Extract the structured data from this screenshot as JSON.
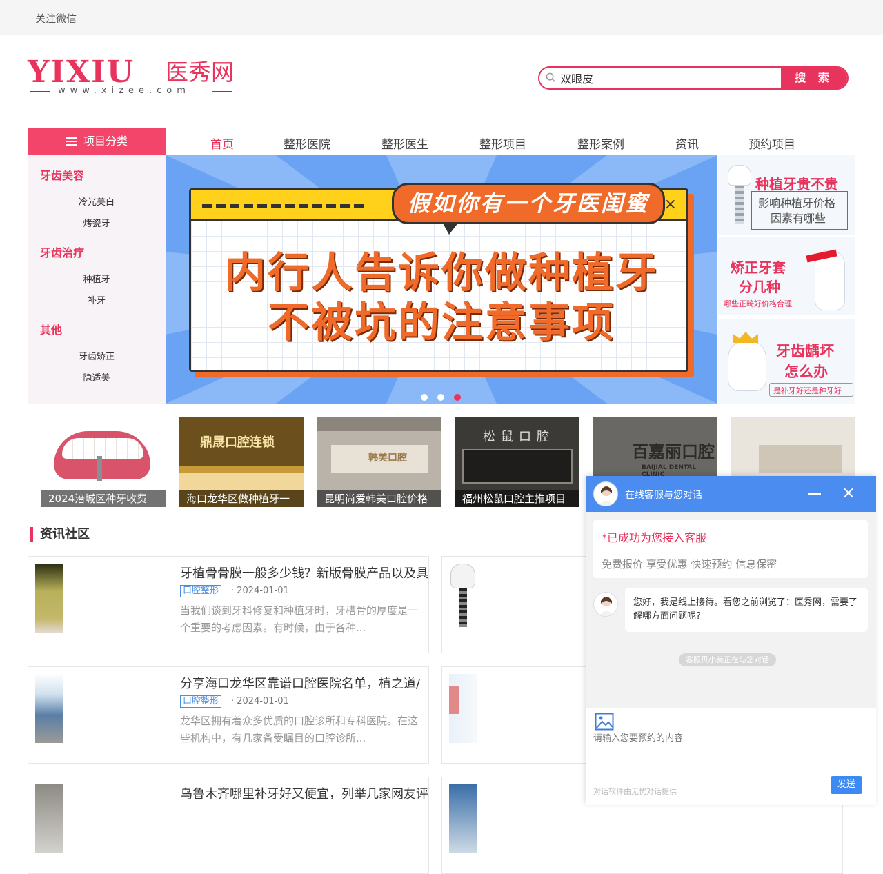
{
  "topbar": {
    "follow_wechat": "关注微信"
  },
  "logo": {
    "en": "YIXIU",
    "cn": "医秀网",
    "url": "www.xizee.com"
  },
  "search": {
    "value": "双眼皮",
    "button": "搜 索"
  },
  "nav": {
    "category_button": "项目分类",
    "items": [
      {
        "label": "首页",
        "active": true
      },
      {
        "label": "整形医院"
      },
      {
        "label": "整形医生"
      },
      {
        "label": "整形项目"
      },
      {
        "label": "整形案例"
      },
      {
        "label": "资讯"
      },
      {
        "label": "预约项目"
      }
    ]
  },
  "sidebar": {
    "groups": [
      {
        "title": "牙齿美容",
        "items": [
          "冷光美白",
          "烤瓷牙"
        ]
      },
      {
        "title": "牙齿治疗",
        "items": [
          "种植牙",
          "补牙"
        ]
      },
      {
        "title": "其他",
        "items": [
          "牙齿矫正",
          "隐适美"
        ]
      }
    ]
  },
  "banner": {
    "bubble": "假如你有一个牙医闺蜜",
    "line1": "内行人告诉你做种植牙",
    "line2": "不被坑的注意事项",
    "close": "×",
    "dots": 3,
    "active_dot": 2
  },
  "promos": [
    {
      "t1": "种植牙贵不贵",
      "t2": "影响种植牙价格",
      "t3": "因素有哪些"
    },
    {
      "t1": "矫正牙套",
      "t2": "分几种",
      "t3": "哪些正畸好价格合理"
    },
    {
      "t1": "牙齿龋坏",
      "t2": "怎么办",
      "t3": "是补牙好还是种牙好"
    }
  ],
  "thumbnails": [
    {
      "caption": "2024涪城区种牙收费"
    },
    {
      "caption": "海口龙华区做种植牙一"
    },
    {
      "caption": "昆明尚爱韩美口腔价格"
    },
    {
      "caption": "福州松鼠口腔主推项目"
    },
    {
      "caption": ""
    },
    {
      "caption": ""
    }
  ],
  "thumb_signs": {
    "t2": "鼎晟口腔连锁",
    "t3": "韩美口腔",
    "t4": "松鼠口腔",
    "t5": "百嘉丽口腔",
    "t5_en": "BAIJIAL DENTAL CLINIC"
  },
  "section": {
    "title": "资讯社区"
  },
  "articles": [
    {
      "title": "牙植骨骨膜一般多少钱？新版骨膜产品以及具",
      "tag": "口腔整形",
      "date": "· 2024-01-01",
      "desc": "当我们谈到牙科修复和种植牙时，牙槽骨的厚度是一个重要的考虑因素。有时候，由于各种..."
    },
    {
      "title": "分享海口龙华区靠谱口腔医院名单，植之道/",
      "tag": "口腔整形",
      "date": "· 2024-01-01",
      "desc": "龙华区拥有着众多优质的口腔诊所和专科医院。在这些机构中，有几家备受瞩目的口腔诊所..."
    },
    {
      "title": "乌鲁木齐哪里补牙好又便宜，列举几家网友评",
      "tag": "",
      "date": "",
      "desc": ""
    }
  ],
  "chat": {
    "title": "在线客服与您对话",
    "close": "×",
    "notice_line1": "*已成功为您接入客服",
    "notice_line2": "免费报价 享受优惠 快速预约 信息保密",
    "message": "您好，我是线上接待。看您之前浏览了：医秀网，需要了解哪方面问题呢?",
    "system_note": "客服贝小美正在与您对话",
    "input_placeholder": "请输入您要预约的内容",
    "powered_by": "对话软件由无忧对话提供",
    "send": "发送"
  },
  "colors": {
    "accent": "#e8335d",
    "chat_blue": "#4a8cf0",
    "banner_blue": "#6aa3f3",
    "banner_orange": "#f06a2a"
  }
}
